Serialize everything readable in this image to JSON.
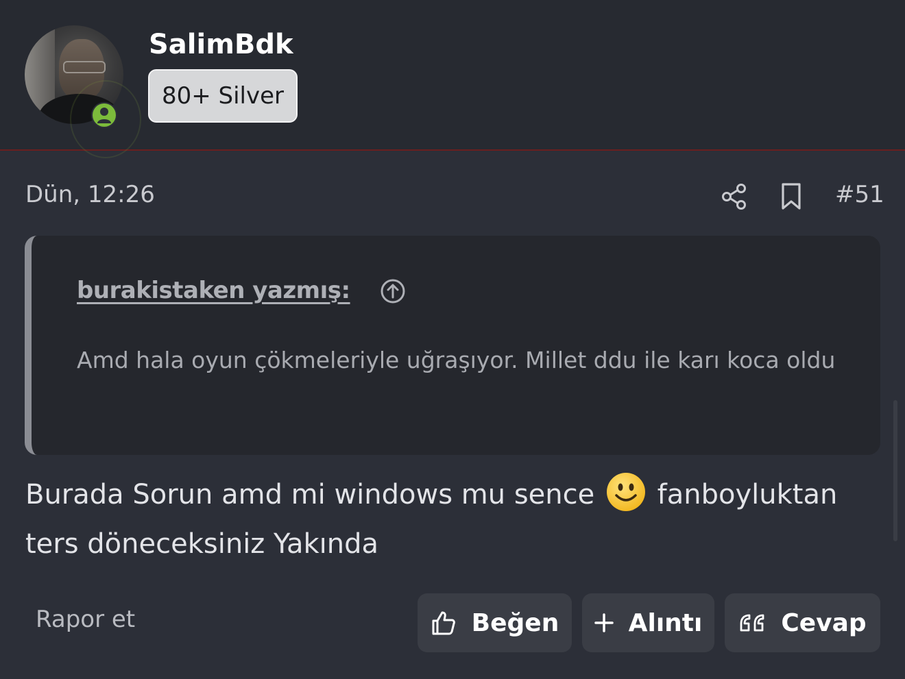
{
  "header": {
    "username": "SalimBdk",
    "badge": "80+ Silver",
    "online_status_icon": "user-icon",
    "accent_border_color": "#6a1f1f",
    "online_color": "#7cbb3b"
  },
  "meta": {
    "timestamp": "Dün, 12:26",
    "post_number": "#51",
    "icons": [
      "share-icon",
      "bookmark-icon"
    ]
  },
  "quote": {
    "author": "burakistaken yazmış:",
    "jump_icon": "arrow-up-circle-icon",
    "text": "Amd hala oyun çökmeleriyle uğraşıyor. Millet ddu ile karı koca oldu"
  },
  "message": {
    "part1": "Burada Sorun amd mi windows mu sence",
    "emoji": "smiley-emoji",
    "part2": "fanboyluktan ters döneceksiniz Yakında"
  },
  "actions": {
    "report": "Rapor et",
    "like": "Beğen",
    "quote": "Alıntı",
    "reply": "Cevap"
  }
}
